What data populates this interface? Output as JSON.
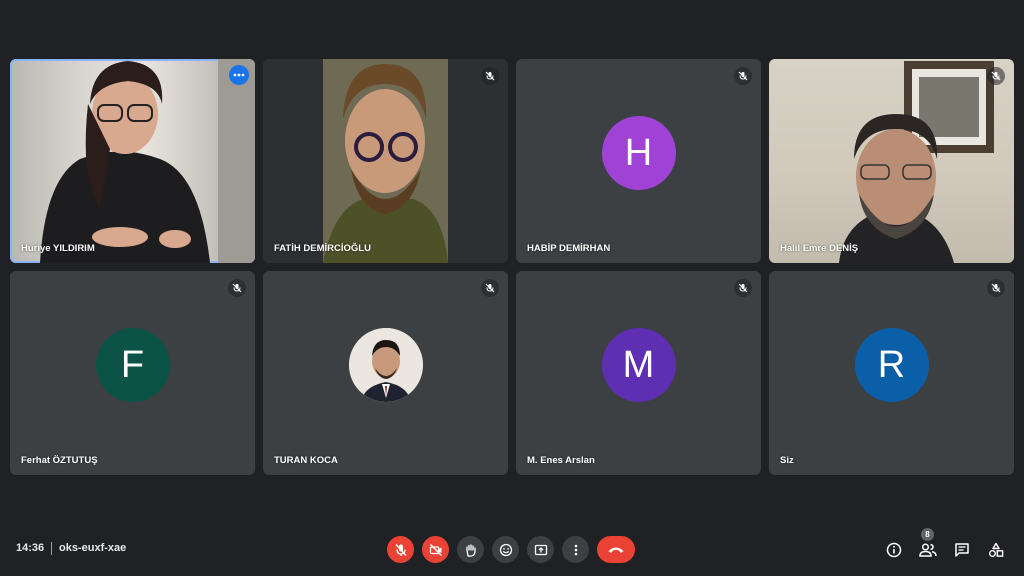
{
  "participants": [
    {
      "name": "Huriye YILDIRIM",
      "type": "video"
    },
    {
      "name": "FATİH DEMİRCİOĞLU",
      "type": "video"
    },
    {
      "name": "HABİP DEMİRHAN",
      "type": "initial",
      "initial": "H",
      "color": "#a142d6"
    },
    {
      "name": "Halil Emre DENİŞ",
      "type": "video"
    },
    {
      "name": "Ferhat ÖZTUTUŞ",
      "type": "initial",
      "initial": "F",
      "color": "#0b5347"
    },
    {
      "name": "TURAN KOCA",
      "type": "photo"
    },
    {
      "name": "M. Enes Arslan",
      "type": "initial",
      "initial": "M",
      "color": "#5e2fb3"
    },
    {
      "name": "Siz",
      "type": "initial",
      "initial": "R",
      "color": "#0b5fa8"
    }
  ],
  "meeting": {
    "time": "14:36",
    "code": "oks-euxf-xae"
  },
  "people_count": "8",
  "colors": {
    "background": "#202124",
    "tile": "#3c4043",
    "danger": "#ea4335",
    "active_border": "#8ab4f8"
  },
  "icons": [
    "mic-off-icon",
    "more-options-icon",
    "camera-off-icon",
    "raise-hand-icon",
    "emoji-icon",
    "present-icon",
    "more-vert-icon",
    "end-call-icon",
    "info-icon",
    "people-icon",
    "chat-icon",
    "activities-icon"
  ]
}
